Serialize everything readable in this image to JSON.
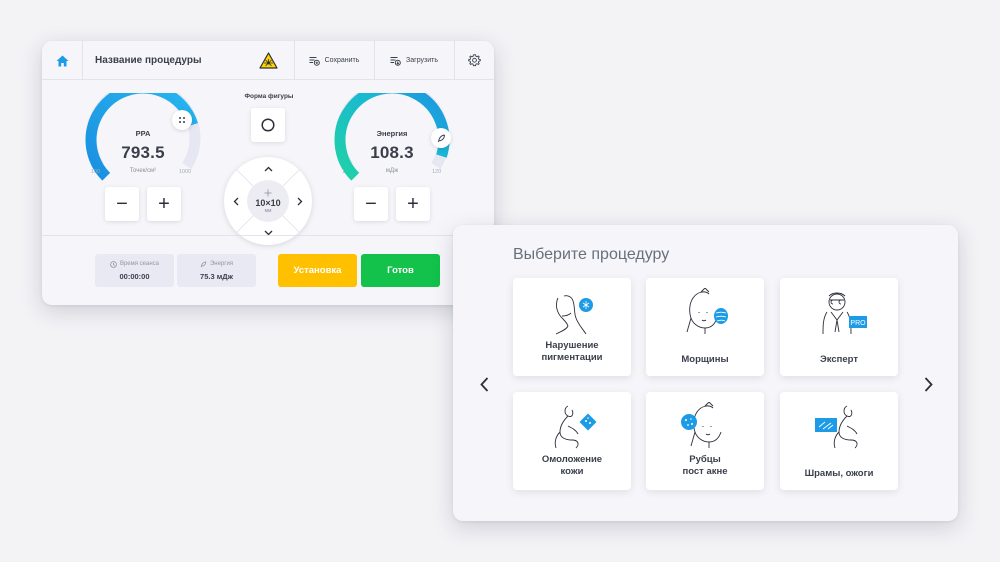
{
  "control_panel": {
    "header": {
      "title": "Название процедуры",
      "save_label": "Сохранить",
      "load_label": "Загрузить",
      "home_icon": "home-icon",
      "warning_icon": "laser-warning-icon",
      "settings_icon": "gear-icon"
    },
    "gauge_ppa": {
      "label": "PPA",
      "value": "793.5",
      "unit": "Точек/см²",
      "min": "100",
      "max": "1000",
      "level": 0.77,
      "badge_icon": "grid-dots-icon"
    },
    "gauge_energy": {
      "label": "Энергия",
      "value": "108.3",
      "unit": "мДж",
      "min": "1",
      "max": "120",
      "level": 0.9,
      "badge_icon": "feather-icon"
    },
    "shape": {
      "caption": "Форма фигуры",
      "selected": "circle-shape-icon"
    },
    "size_pad": {
      "size": "10×10",
      "unit": "мм"
    },
    "session_time": {
      "title": "Время сеанса",
      "value": "00:00:00"
    },
    "session_energy": {
      "title": "Энергия",
      "value": "75.3 мДж"
    },
    "setup_button": "Установка",
    "ready_button": "Готов",
    "colors": {
      "accent_blue": "#1d9be6",
      "accent_teal": "#1fcfa8",
      "setup_yellow": "#ffc000",
      "ready_green": "#12c24a"
    }
  },
  "chooser": {
    "title": "Выберите процедуру",
    "cards": [
      {
        "label": "Нарушение\nпигментации",
        "icon": "pigmentation-icon"
      },
      {
        "label": "Морщины",
        "icon": "wrinkles-icon"
      },
      {
        "label": "Эксперт",
        "icon": "expert-pro-icon"
      },
      {
        "label": "Омоложение\nкожи",
        "icon": "rejuvenation-icon"
      },
      {
        "label": "Рубцы\nпост акне",
        "icon": "acne-scars-icon"
      },
      {
        "label": "Шрамы, ожоги",
        "icon": "scars-burns-icon"
      }
    ],
    "pro_badge": "PRO"
  }
}
